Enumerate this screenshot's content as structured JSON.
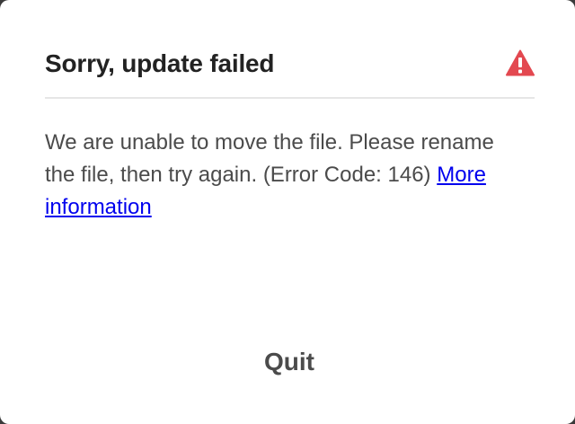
{
  "dialog": {
    "title": "Sorry, update failed",
    "alert_icon": "alert-triangle-icon",
    "message": "We are unable to move the file. Please rename the file, then try again. (Error Code: 146)",
    "link_label": "More information",
    "quit_label": "Quit"
  },
  "colors": {
    "alert_red": "#e34850",
    "link_blue": "#0000ee",
    "title_text": "#222222",
    "body_text": "#4b4b4b"
  }
}
